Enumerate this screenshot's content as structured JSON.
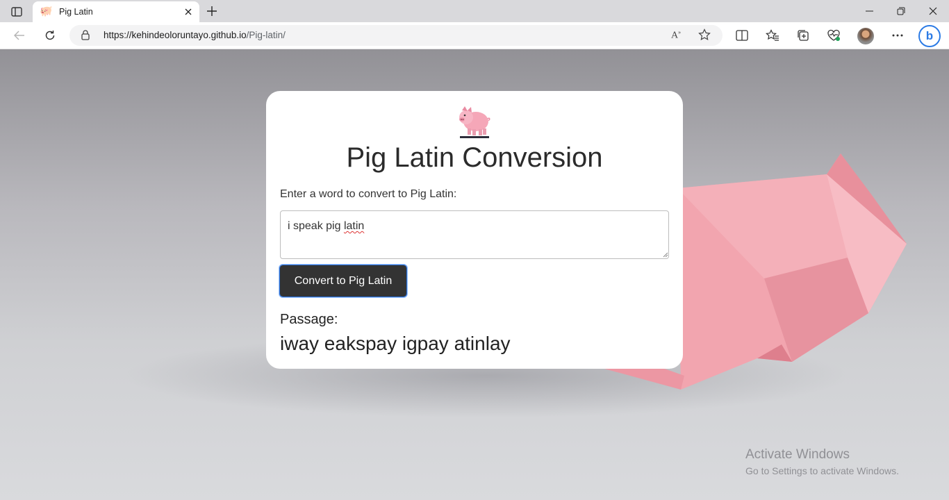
{
  "browser": {
    "tab": {
      "title": "Pig Latin",
      "favicon": "🐖"
    },
    "address": {
      "host": "https://kehindeoloruntayo.github.io",
      "path": "/Pig-latin/"
    },
    "icons": [
      "sidebar-icon",
      "close-icon",
      "plus-icon",
      "minimize-icon",
      "maximize-icon",
      "window-close-icon",
      "back-icon",
      "refresh-icon",
      "lock-icon",
      "read-aloud-icon",
      "favorite-star-icon",
      "split-screen-icon",
      "favorites-icon",
      "collections-icon",
      "performance-icon",
      "avatar",
      "more-icon",
      "bing-icon"
    ]
  },
  "page": {
    "emoji": "🐖",
    "title": "Pig Latin Conversion",
    "prompt": "Enter a word to convert to Pig Latin:",
    "input": {
      "value_plain": "i speak pig ",
      "value_flagged": "latin"
    },
    "button": "Convert to Pig Latin",
    "passage_label": "Passage:",
    "passage_output": "iway eakspay igpay atinlay"
  },
  "watermark": {
    "line1": "Activate Windows",
    "line2": "Go to Settings to activate Windows."
  },
  "colors": {
    "button_bg": "#333333",
    "card_bg": "#ffffff",
    "accent": "#2c7be5"
  }
}
